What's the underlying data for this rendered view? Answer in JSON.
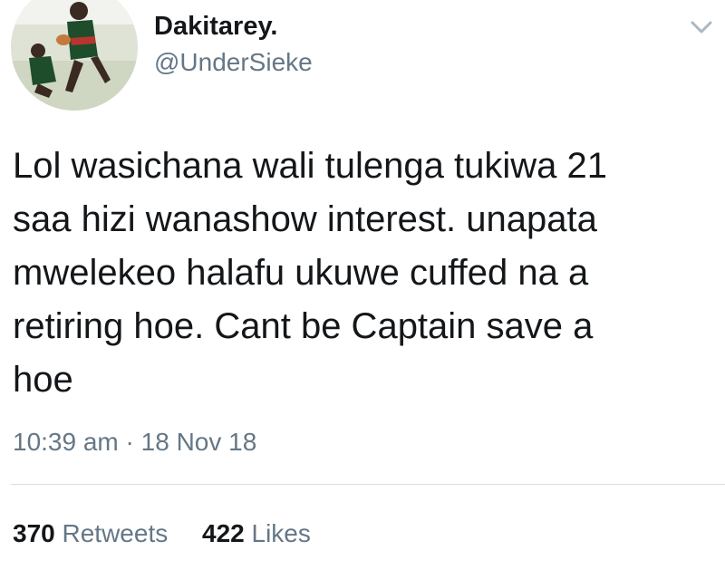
{
  "user": {
    "display_name": "Dakitarey.",
    "handle": "@UnderSieke"
  },
  "icons": {
    "avatar": "rugby-player-avatar",
    "menu": "chevron-down-icon"
  },
  "tweet": {
    "text": "Lol wasichana wali tulenga tukiwa 21\nsaa hizi wanashow interest. unapata\nmwelekeo halafu ukuwe cuffed na a\nretiring hoe. Cant be Captain save a\nhoe",
    "time": "10:39 am",
    "separator": "·",
    "date": "18 Nov 18"
  },
  "stats": {
    "retweets_count": "370",
    "retweets_label": "Retweets",
    "likes_count": "422",
    "likes_label": "Likes"
  },
  "colors": {
    "text": "#14171a",
    "secondary": "#657786",
    "divider": "#d9dee2"
  }
}
